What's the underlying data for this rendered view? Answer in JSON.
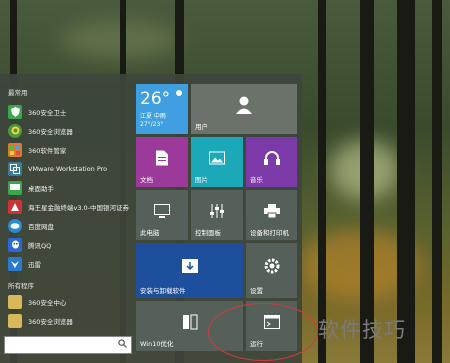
{
  "sections": {
    "recent": "最常用",
    "all_programs": "所有程序"
  },
  "recent_apps": [
    {
      "label": "360安全卫士",
      "icon": "shield-icon",
      "color": "#3aa84a"
    },
    {
      "label": "360安全浏览器",
      "icon": "browser-icon",
      "color": "#4a9a3a"
    },
    {
      "label": "360软件管家",
      "icon": "app-store-icon",
      "color": "#e07a2a"
    },
    {
      "label": "VMware Workstation Pro",
      "icon": "vmware-icon",
      "color": "#3a7a9a"
    },
    {
      "label": "桌面助手",
      "icon": "desktop-helper-icon",
      "color": "#3aa84a"
    },
    {
      "label": "海王星金融终端v3.0-中国银河证券",
      "icon": "finance-icon",
      "color": "#cc3333"
    },
    {
      "label": "百度网盘",
      "icon": "cloud-icon",
      "color": "#2a8ad4"
    },
    {
      "label": "腾讯QQ",
      "icon": "qq-icon",
      "color": "#2a6ad4"
    },
    {
      "label": "迅雷",
      "icon": "thunder-icon",
      "color": "#2a7ad4"
    }
  ],
  "all_apps": [
    {
      "label": "360安全中心",
      "icon": "folder-icon",
      "color": "#d8b85a"
    },
    {
      "label": "360安全浏览器",
      "icon": "folder-icon",
      "color": "#d8b85a"
    }
  ],
  "tiles": {
    "weather": {
      "temp": "26°",
      "line1": "江夏 中雨",
      "line2": "27°/23°"
    },
    "user": {
      "label": "用户"
    },
    "documents": {
      "label": "文档"
    },
    "pictures": {
      "label": "图片"
    },
    "music": {
      "label": "音乐"
    },
    "this_pc": {
      "label": "此电脑"
    },
    "control_panel": {
      "label": "控制面板"
    },
    "devices_printers": {
      "label": "设备和打印机"
    },
    "install_uninstall": {
      "label": "安装与卸载软件"
    },
    "settings": {
      "label": "设置"
    },
    "win10_optimize": {
      "label": "Win10优化"
    },
    "run": {
      "label": "运行"
    }
  },
  "watermark": "软件技巧",
  "colors": {
    "weather": "#3f9fe0",
    "purple": "#9b3a9b",
    "teal": "#1ba8b8",
    "blue": "#1d4f9c",
    "gray": "#6b7269",
    "dark": "#55605a"
  }
}
